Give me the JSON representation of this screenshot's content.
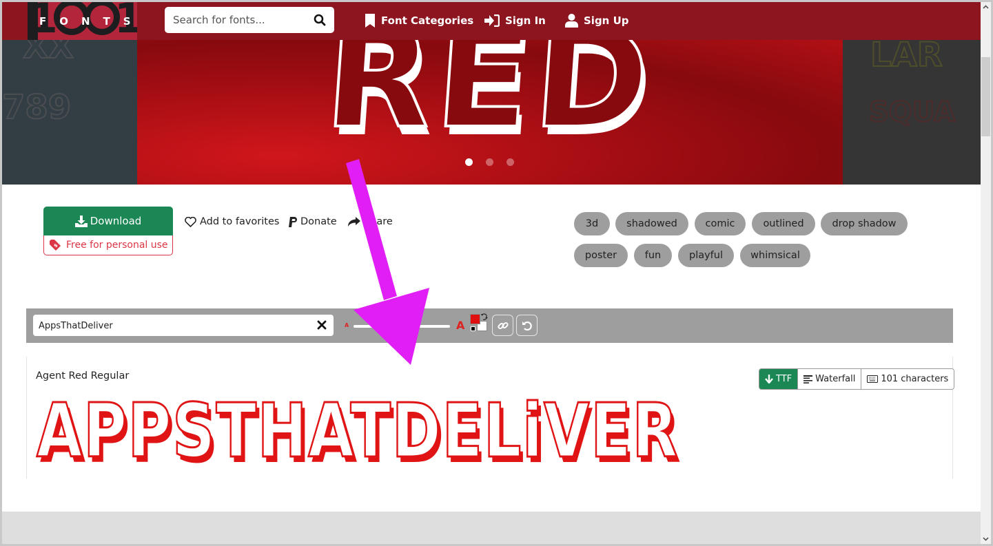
{
  "navbar": {
    "logo": {
      "digits": "1001",
      "word": "FONTS"
    },
    "search": {
      "placeholder": "Search for fonts...",
      "value": ""
    },
    "links": [
      {
        "label": "Font Categories",
        "icon": "bookmark-icon"
      },
      {
        "label": "Sign In",
        "icon": "sign-in-icon"
      },
      {
        "label": "Sign Up",
        "icon": "user-icon"
      }
    ]
  },
  "hero": {
    "title": "RED",
    "left_preview_text": [
      "XX",
      "789"
    ],
    "right_preview_text": [
      "LAR",
      "SQUA"
    ],
    "slides": 3,
    "active_slide": 1
  },
  "actions": {
    "download_label": "Download",
    "license_label": "Free for personal use",
    "favorites_label": "Add to favorites",
    "donate_label": "Donate",
    "share_label": "Share"
  },
  "tags": [
    "3d",
    "shadowed",
    "comic",
    "outlined",
    "drop shadow",
    "poster",
    "fun",
    "playful",
    "whimsical"
  ],
  "toolbar": {
    "preview_text_value": "AppsThatDeliver",
    "size_small_label": "A",
    "size_large_label": "A",
    "foreground_color": "#e01010",
    "background_color": "#ffffff"
  },
  "preview": {
    "font_name": "Agent Red Regular",
    "buttons": [
      {
        "label": "TTF",
        "icon": "arrow-down-icon",
        "active": true
      },
      {
        "label": "Waterfall",
        "icon": "align-left-icon",
        "active": false
      },
      {
        "label": "101 characters",
        "icon": "keyboard-icon",
        "active": false
      }
    ],
    "sample_text": "APPSTHATDELiVER"
  },
  "colors": {
    "brand_red": "#8c1520",
    "download_green": "#1a8754",
    "license_red": "#dc3545",
    "tag_gray": "#9e9e9e",
    "annotation_magenta": "#e01ef5"
  }
}
